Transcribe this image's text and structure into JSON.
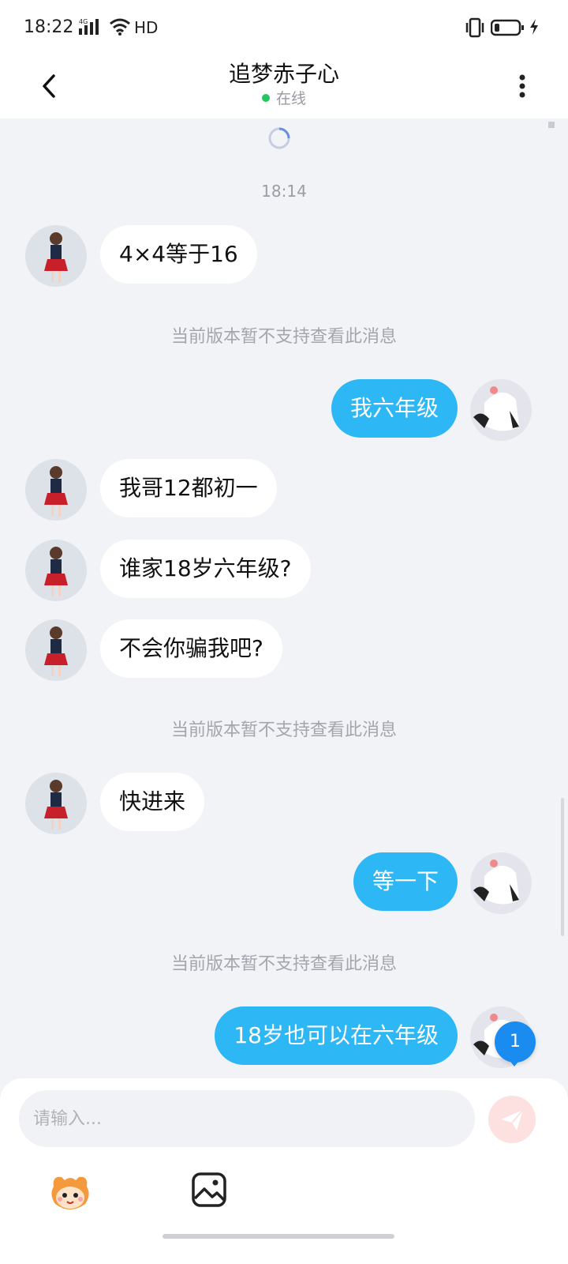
{
  "status_bar": {
    "time": "18:22",
    "network": "4G",
    "hd": "HD"
  },
  "header": {
    "title": "追梦赤子心",
    "status": "在线",
    "status_color": "#22c55e"
  },
  "chat": {
    "timestamp": "18:14",
    "messages": [
      {
        "side": "left",
        "text": "4×4等于16"
      },
      {
        "side": "system",
        "text": "当前版本暂不支持查看此消息"
      },
      {
        "side": "right",
        "text": "我六年级"
      },
      {
        "side": "left",
        "text": "我哥12都初一"
      },
      {
        "side": "left",
        "text": "谁家18岁六年级?"
      },
      {
        "side": "left",
        "text": "不会你骗我吧?"
      },
      {
        "side": "system",
        "text": "当前版本暂不支持查看此消息"
      },
      {
        "side": "left",
        "text": "快进来"
      },
      {
        "side": "right",
        "text": "等一下"
      },
      {
        "side": "system",
        "text": "当前版本暂不支持查看此消息"
      },
      {
        "side": "right",
        "text": "18岁也可以在六年级"
      }
    ],
    "unread_badge": "1",
    "outgoing_color": "#2db7f5"
  },
  "composer": {
    "placeholder": "请输入..."
  },
  "icons": {
    "back": "back-arrow-icon",
    "more": "more-vertical-icon",
    "send": "send-icon",
    "emoji": "emoji-mascot-icon",
    "image": "image-icon"
  }
}
